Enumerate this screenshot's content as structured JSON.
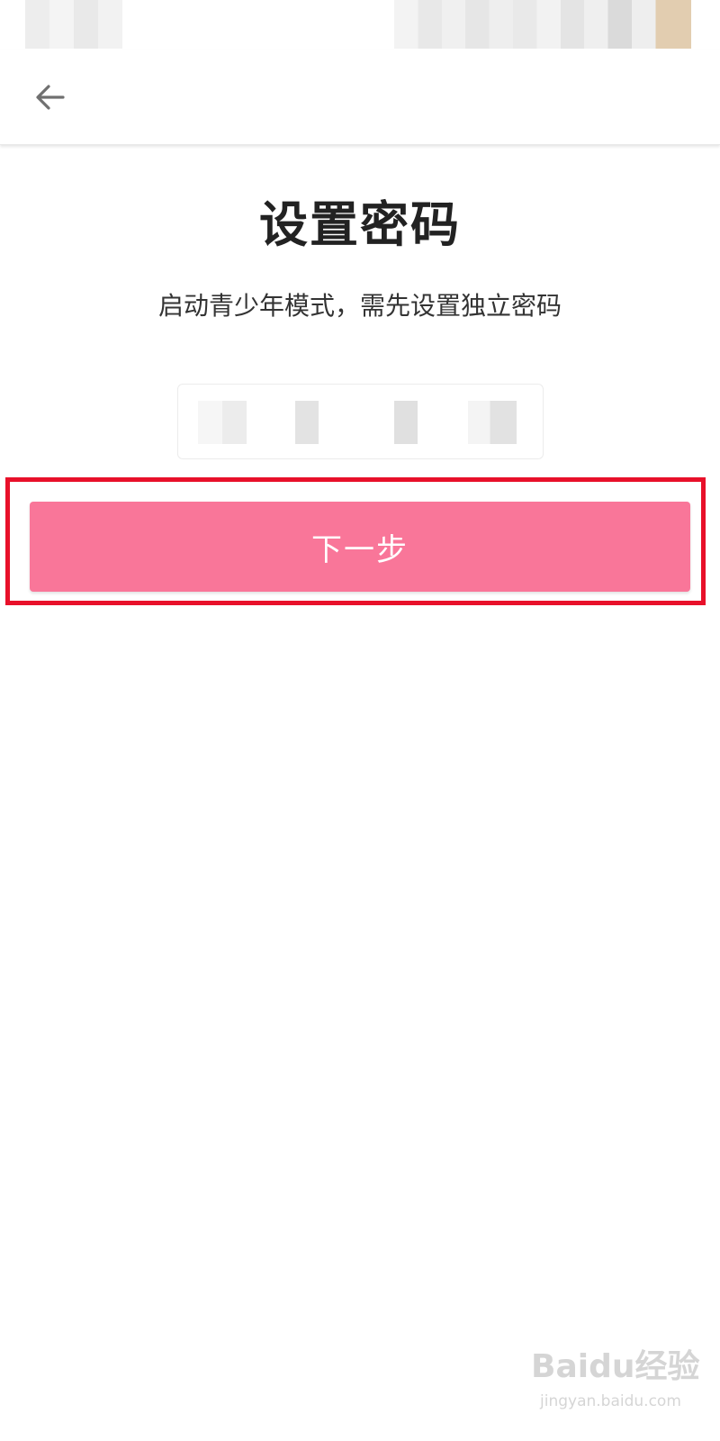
{
  "page": {
    "title": "设置密码",
    "subtitle": "启动青少年模式，需先设置独立密码"
  },
  "toolbar": {
    "back_icon": "arrow-left-icon"
  },
  "password": {
    "digit_count": 4
  },
  "actions": {
    "next_label": "下一步"
  },
  "watermark": {
    "logo": "Baidu经验",
    "url": "jingyan.baidu.com"
  },
  "colors": {
    "primary_button": "#f97699",
    "highlight_frame": "#e8102a",
    "title_text": "#222222"
  }
}
